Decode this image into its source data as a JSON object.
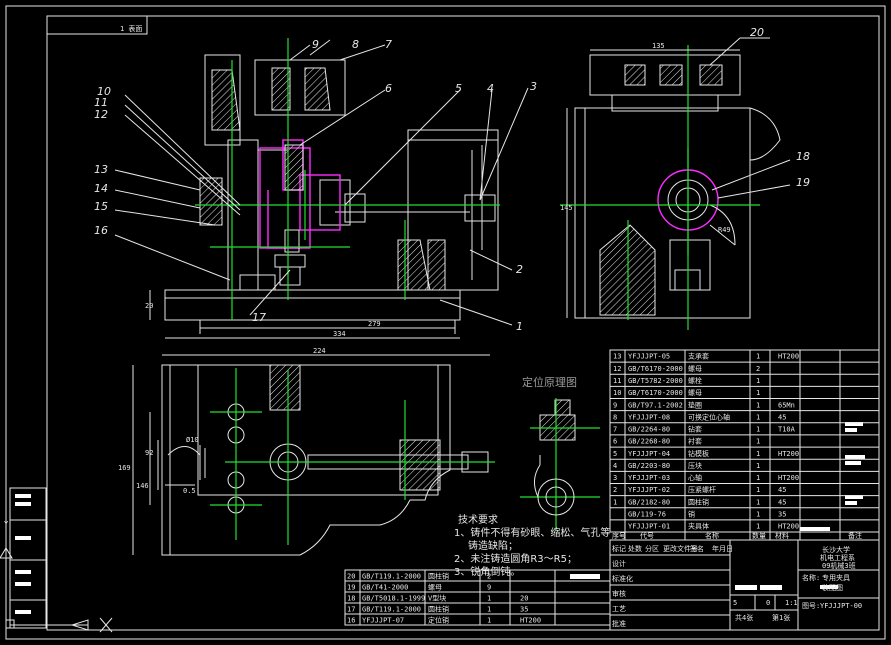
{
  "drawing": {
    "corner_tag": "1 表面",
    "caption": "定位原理图",
    "callouts": [
      "1",
      "2",
      "3",
      "4",
      "5",
      "6",
      "7",
      "8",
      "9",
      "10",
      "11",
      "12",
      "13",
      "14",
      "15",
      "16",
      "17",
      "18",
      "19",
      "20"
    ],
    "dimensions": {
      "d_top": "20",
      "d_front_1": "20",
      "d_front_2": "279",
      "d_front_3": "334",
      "d_top_w": "224",
      "d_left_1": "169",
      "d_left_2": "146",
      "d_left_3": "92",
      "d_hole": "Ø10",
      "d_small": "0.5",
      "d_side_h": "145",
      "d_side_w": "135",
      "d_r": "R49"
    },
    "tech_req": {
      "title": "技术要求",
      "items": [
        "1、铸件不得有砂眼、缩松、气孔等",
        "铸造缺陷；",
        "2、未注铸造圆角R3～R5；",
        "3、锐角倒钝。"
      ]
    },
    "bom_upper": [
      {
        "no": "13",
        "code": "YFJJJPT-05",
        "name": "支承套",
        "qty": "1",
        "mat": "HT200"
      },
      {
        "no": "12",
        "code": "GB/T6170-2000",
        "name": "螺母",
        "qty": "2",
        "mat": ""
      },
      {
        "no": "11",
        "code": "GB/T5782-2000",
        "name": "螺栓",
        "qty": "1",
        "mat": ""
      },
      {
        "no": "10",
        "code": "GB/T6170-2000",
        "name": "螺母",
        "qty": "1",
        "mat": ""
      },
      {
        "no": "9",
        "code": "GB/T97.1-2002",
        "name": "垫圈",
        "qty": "1",
        "mat": "65Mn"
      },
      {
        "no": "8",
        "code": "YFJJJPT-08",
        "name": "可换定位心轴",
        "qty": "1",
        "mat": "45"
      },
      {
        "no": "7",
        "code": "GB/2264-80",
        "name": "钻套",
        "qty": "1",
        "mat": "T10A"
      },
      {
        "no": "6",
        "code": "GB/2268-80",
        "name": "衬套",
        "qty": "1",
        "mat": ""
      },
      {
        "no": "5",
        "code": "YFJJJPT-04",
        "name": "钻模板",
        "qty": "1",
        "mat": "HT200"
      },
      {
        "no": "4",
        "code": "GB/2203-80",
        "name": "压块",
        "qty": "1",
        "mat": ""
      },
      {
        "no": "3",
        "code": "YFJJJPT-03",
        "name": "心轴",
        "qty": "1",
        "mat": "HT200"
      },
      {
        "no": "2",
        "code": "YFJJJPT-02",
        "name": "压紧螺杆",
        "qty": "1",
        "mat": "45"
      },
      {
        "no": "1",
        "code": "GB/2182-80",
        "name": "圆柱销",
        "qty": "1",
        "mat": "45"
      },
      {
        "no": "",
        "code": "GB/119-76",
        "name": "销",
        "qty": "1",
        "mat": "35"
      },
      {
        "no": "",
        "code": "YFJJJPT-01",
        "name": "夹具体",
        "qty": "1",
        "mat": "HT200"
      }
    ],
    "bom_header": {
      "no": "序号",
      "code": "代号",
      "name": "名称",
      "qty": "数量",
      "mat": "材料",
      "note": "备注"
    },
    "bom_lower": [
      {
        "no": "20",
        "code": "GB/T119.1-2000",
        "name": "圆柱销",
        "qty": "2",
        "mat": ""
      },
      {
        "no": "19",
        "code": "GB/T41-2000",
        "name": "螺母",
        "qty": "9",
        "mat": ""
      },
      {
        "no": "18",
        "code": "GB/T5018.1-1999",
        "name": "V型块",
        "qty": "1",
        "mat": "20"
      },
      {
        "no": "17",
        "code": "GB/T119.1-2000",
        "name": "圆柱销",
        "qty": "1",
        "mat": "35"
      },
      {
        "no": "16",
        "code": "YFJJJPT-07",
        "name": "定位销",
        "qty": "1",
        "mat": "HT200"
      }
    ],
    "title_block": {
      "org1": "长沙大学",
      "org2": "机电工程系",
      "org3": "09机械3班",
      "name_label": "名称:",
      "name_value": "专用夹具",
      "name_value2": "装配图",
      "code_label": "图号:",
      "code_value": "YFJJJPT-00",
      "scale": "1:1",
      "sheets": "共4张",
      "sheet": "第1张",
      "s1": "5",
      "s2": "0",
      "row_labels": [
        "标记",
        "处数",
        "分区",
        "更改文件号",
        "签名",
        "年月日"
      ],
      "row_labels2": [
        "设计",
        "标准化",
        "审核",
        "工艺",
        "批准"
      ]
    }
  }
}
